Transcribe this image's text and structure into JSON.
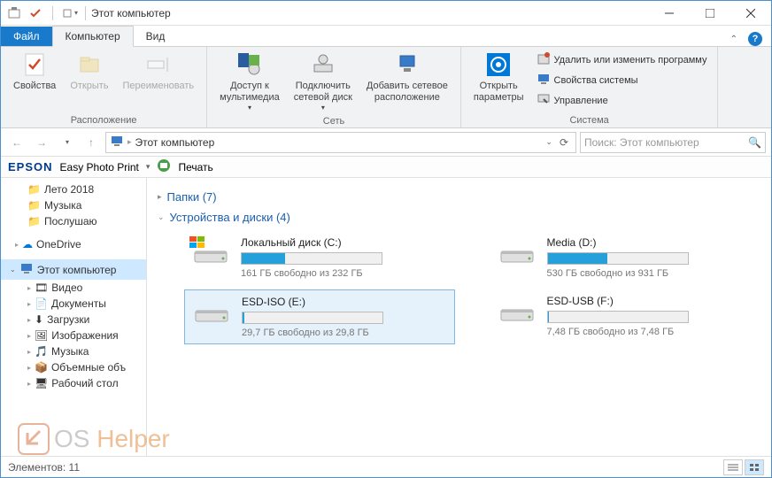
{
  "title": "Этот компьютер",
  "tabs": {
    "file": "Файл",
    "computer": "Компьютер",
    "view": "Вид"
  },
  "ribbon": {
    "location_group": "Расположение",
    "network_group": "Сеть",
    "system_group": "Система",
    "properties": "Свойства",
    "open": "Открыть",
    "rename": "Переименовать",
    "multimedia": "Доступ к\nмультимедиа",
    "map_drive": "Подключить\nсетевой диск",
    "add_net_loc": "Добавить сетевое\nрасположение",
    "open_params": "Открыть\nпараметры",
    "uninstall": "Удалить или изменить программу",
    "sys_props": "Свойства системы",
    "manage": "Управление"
  },
  "address": "Этот компьютер",
  "search_placeholder": "Поиск: Этот компьютер",
  "epson": {
    "label": "Easy Photo Print",
    "print": "Печать"
  },
  "sidebar": {
    "summer": "Лето 2018",
    "music": "Музыка",
    "listen": "Послушаю",
    "onedrive": "OneDrive",
    "thispc": "Этот компьютер",
    "video": "Видео",
    "documents": "Документы",
    "downloads": "Загрузки",
    "images": "Изображения",
    "music2": "Музыка",
    "volumes": "Объемные объ",
    "desktop": "Рабочий стол"
  },
  "groups": {
    "folders": "Папки (7)",
    "drives": "Устройства и диски (4)"
  },
  "drives": [
    {
      "name": "Локальный диск (C:)",
      "free": "161 ГБ свободно из 232 ГБ",
      "fill": 31,
      "win": true
    },
    {
      "name": "Media (D:)",
      "free": "530 ГБ свободно из 931 ГБ",
      "fill": 43,
      "win": false
    },
    {
      "name": "ESD-ISO (E:)",
      "free": "29,7 ГБ свободно из 29,8 ГБ",
      "fill": 1,
      "selected": true,
      "win": false
    },
    {
      "name": "ESD-USB (F:)",
      "free": "7,48 ГБ свободно из 7,48 ГБ",
      "fill": 1,
      "win": false
    }
  ],
  "status": "Элементов: 11",
  "watermark": {
    "os": "OS ",
    "helper": "Helper"
  }
}
